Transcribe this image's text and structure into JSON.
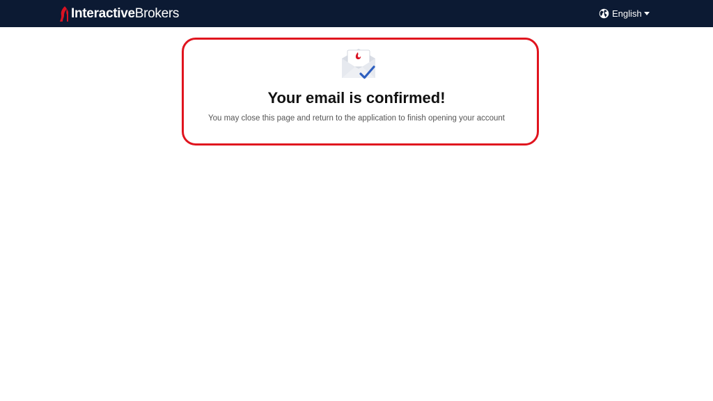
{
  "header": {
    "logo_text_bold": "Interactive",
    "logo_text_light": "Brokers",
    "language_label": "English",
    "background": "#0c1a33"
  },
  "icons": {
    "logo": "ib-flame-logo-icon",
    "language": "globe-icon",
    "dropdown": "caret-down-icon",
    "email": "email-confirmed-icon"
  },
  "confirmation": {
    "title": "Your email is confirmed!",
    "message": "You may close this page and return to the application to finish opening your account"
  },
  "colors": {
    "brand_red": "#d81222",
    "highlight": "#e0141e",
    "check_blue": "#2e5fbf"
  }
}
